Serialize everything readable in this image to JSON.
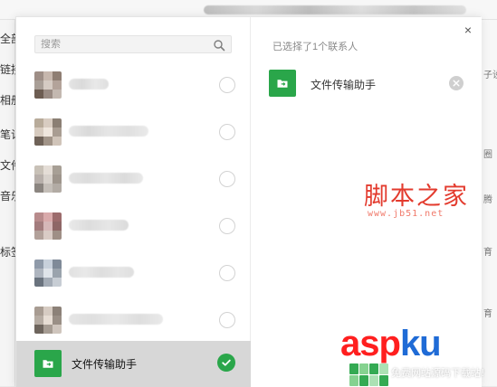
{
  "background": {
    "sidebar_items": [
      "全部",
      "链接",
      "相册",
      "笔记",
      "文件",
      "音乐",
      "标签"
    ],
    "right_column_items": [
      "子设",
      "圈",
      "腾",
      "育",
      "育"
    ]
  },
  "dialog": {
    "search": {
      "placeholder": "搜索",
      "value": ""
    },
    "contacts": [
      {
        "name": "",
        "checked": false,
        "avatar_colors": [
          "#9e8e86",
          "#c7b7ad",
          "#8f7e73",
          "#a99f97",
          "#d5cbc3",
          "#b3a39a",
          "#6d5d52",
          "#9a8c84",
          "#c3b8b0"
        ]
      },
      {
        "name": "",
        "checked": false,
        "avatar_colors": [
          "#b8ab9a",
          "#d8ccc1",
          "#8b7f74",
          "#d7cbbf",
          "#efe6dd",
          "#a99d92",
          "#6f6258",
          "#a19488",
          "#d0c4b9"
        ]
      },
      {
        "name": "",
        "checked": false,
        "avatar_colors": [
          "#c8c1b7",
          "#e4ddd6",
          "#a79f95",
          "#b7afaa",
          "#d7d1cb",
          "#9e958c",
          "#8b8580",
          "#c4beb8",
          "#b2aba4"
        ]
      },
      {
        "name": "",
        "checked": false,
        "avatar_colors": [
          "#b88b8c",
          "#d9aaab",
          "#9c6b6c",
          "#a37c7d",
          "#d6b7b8",
          "#8e6666",
          "#b2a19a",
          "#d9cbc5",
          "#9f8f86"
        ]
      },
      {
        "name": "",
        "checked": false,
        "avatar_colors": [
          "#8f9aa9",
          "#c7d0db",
          "#7f8a98",
          "#aeb5bf",
          "#dfe4ea",
          "#9aa3ad",
          "#6a737e",
          "#a4acb6",
          "#c7cdd4"
        ]
      },
      {
        "name": "",
        "checked": false,
        "avatar_colors": [
          "#a89c92",
          "#d6cbc2",
          "#8c8178",
          "#b6aca3",
          "#e7ddd4",
          "#9a8f86",
          "#6e655d",
          "#a69c93",
          "#cfc5bd"
        ]
      },
      {
        "name": "文件传输助手",
        "checked": true,
        "avatar_icon": "folder-transfer-icon"
      }
    ],
    "selected_header": "已选择了1个联系人",
    "selected_items": [
      {
        "name": "文件传输助手",
        "icon": "folder-transfer-icon"
      }
    ],
    "close_label": "×"
  },
  "watermarks": {
    "jb51_cn": "脚本之家",
    "jb51_url": "www.jb51.net",
    "aspku_logo_a": "asp",
    "aspku_logo_b": "ku",
    "aspku_tagline": "免费网站源码下载站!"
  },
  "colors": {
    "accent_green": "#2aa64a",
    "jb51_red": "#e33b2e",
    "aspku_red": "#ff1f1f",
    "aspku_blue": "#1f6bd6"
  }
}
